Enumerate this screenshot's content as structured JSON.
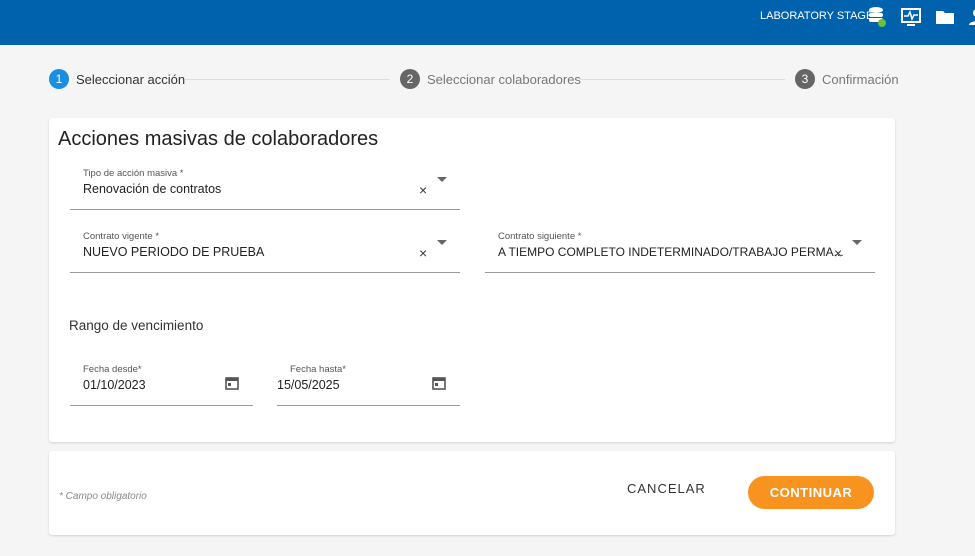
{
  "header": {
    "environment": "LABORATORY STAGE",
    "icons": [
      "database-check-icon",
      "monitor-activity-icon",
      "folder-icon",
      "user-icon"
    ]
  },
  "stepper": [
    {
      "num": "1",
      "label": "Seleccionar acción"
    },
    {
      "num": "2",
      "label": "Seleccionar colaboradores"
    },
    {
      "num": "3",
      "label": "Confirmación"
    }
  ],
  "form": {
    "title": "Acciones masivas de colaboradores",
    "tipo": {
      "label": "Tipo de acción masiva *",
      "value": "Renovación de contratos"
    },
    "vigente": {
      "label": "Contrato vigente *",
      "value": "NUEVO PERIODO DE PRUEBA"
    },
    "siguiente": {
      "label": "Contrato siguiente *",
      "value": "A TIEMPO COMPLETO INDETERMINADO/TRABAJO PERMA..."
    },
    "rango": "Rango de vencimiento",
    "desde": {
      "label": "Fecha desde*",
      "value": "01/10/2023"
    },
    "hasta": {
      "label": "Fecha hasta*",
      "value": "15/05/2025"
    },
    "clear": "×"
  },
  "footer": {
    "required_note": "* Campo obligatorio",
    "cancel": "CANCELAR",
    "continue": "CONTINUAR"
  }
}
